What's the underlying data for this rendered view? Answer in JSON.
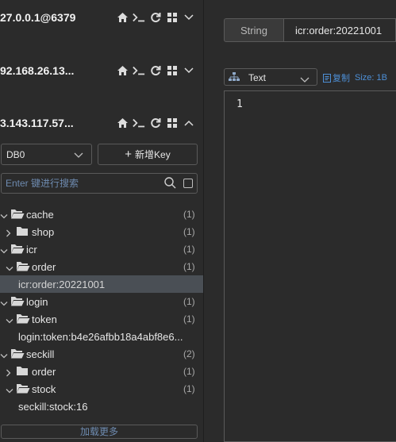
{
  "connections": [
    {
      "name": "27.0.0.1@6379",
      "expanded": false
    },
    {
      "name": "92.168.26.13...",
      "expanded": false
    },
    {
      "name": "3.143.117.57...",
      "expanded": true
    }
  ],
  "icons": {
    "home": "home-icon",
    "terminal": "terminal-icon",
    "refresh": "refresh-icon",
    "grid": "grid-icon"
  },
  "db_select": {
    "value": "DB0"
  },
  "add_key": {
    "label": "新增Key",
    "icon": "+"
  },
  "search": {
    "placeholder": "Enter 键进行搜索",
    "value": ""
  },
  "tree": [
    {
      "label": "cache",
      "count": "(1)",
      "depth": 0,
      "type": "folder",
      "expanded": true
    },
    {
      "label": "shop",
      "count": "(1)",
      "depth": 1,
      "type": "folder",
      "expanded": false
    },
    {
      "label": "icr",
      "count": "(1)",
      "depth": 0,
      "type": "folder",
      "expanded": true
    },
    {
      "label": "order",
      "count": "(1)",
      "depth": 1,
      "type": "folder",
      "expanded": true
    },
    {
      "label": "icr:order:20221001",
      "count": "",
      "depth": 2,
      "type": "key",
      "selected": true
    },
    {
      "label": "login",
      "count": "(1)",
      "depth": 0,
      "type": "folder",
      "expanded": true
    },
    {
      "label": "token",
      "count": "(1)",
      "depth": 1,
      "type": "folder",
      "expanded": true
    },
    {
      "label": "login:token:b4e26afbb18a4abf8e6...",
      "count": "",
      "depth": 2,
      "type": "key"
    },
    {
      "label": "seckill",
      "count": "(2)",
      "depth": 0,
      "type": "folder",
      "expanded": true
    },
    {
      "label": "order",
      "count": "(1)",
      "depth": 1,
      "type": "folder",
      "expanded": false
    },
    {
      "label": "stock",
      "count": "(1)",
      "depth": 1,
      "type": "folder",
      "expanded": true
    },
    {
      "label": "seckill:stock:16",
      "count": "",
      "depth": 2,
      "type": "key"
    }
  ],
  "load_more": "加载更多",
  "detail": {
    "type_label": "String",
    "key_name": "icr:order:20221001",
    "format": "Text",
    "copy_label": "复制",
    "size_label": "Size: 1B",
    "line_number": "1",
    "value": ""
  },
  "colors": {
    "background": "#2b2b2b",
    "border": "#5a5a5a",
    "selected_row": "#4a4f55",
    "link": "#4d8fd6",
    "placeholder": "#6e8bb0"
  }
}
